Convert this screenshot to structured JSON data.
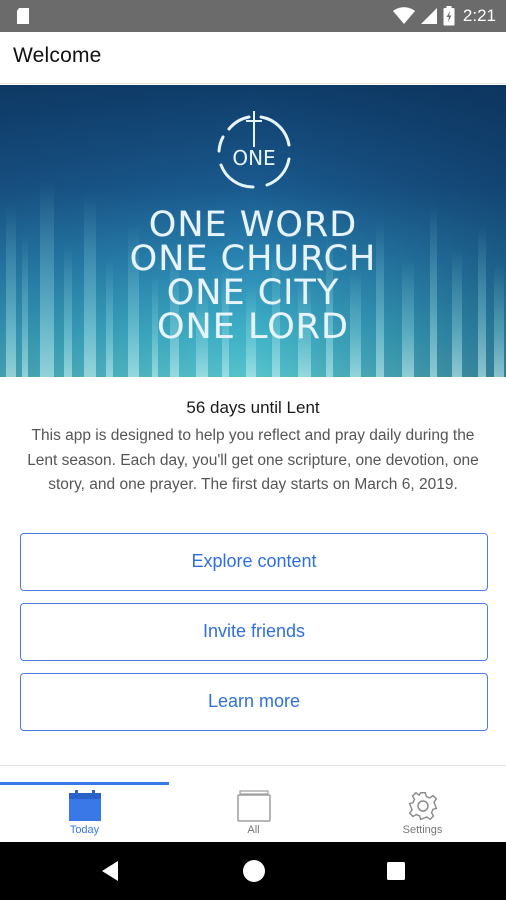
{
  "status_bar": {
    "time": "2:21",
    "left_icon": "sd-card-icon",
    "right_icons": [
      "wifi-icon",
      "signal-icon",
      "battery-icon"
    ]
  },
  "app_bar": {
    "title": "Welcome"
  },
  "hero": {
    "logo_text": "ONE",
    "lines": [
      "ONE WORD",
      "ONE CHURCH",
      "ONE CITY",
      "ONE LORD"
    ]
  },
  "main": {
    "countdown": "56 days until Lent",
    "description": "This app is designed to help you reflect and pray daily during the Lent season. Each day, you'll get one scripture, one devotion, one story, and one prayer. The first day starts on March 6, 2019.",
    "buttons": {
      "explore": "Explore content",
      "invite": "Invite friends",
      "learn": "Learn more"
    }
  },
  "bottom_nav": {
    "items": [
      {
        "label": "Today",
        "icon": "calendar-icon",
        "active": true
      },
      {
        "label": "All",
        "icon": "folder-icon",
        "active": false
      },
      {
        "label": "Settings",
        "icon": "gear-icon",
        "active": false
      }
    ]
  },
  "colors": {
    "accent": "#3b78e7",
    "button_text": "#2f6fe0",
    "status_bar": "#6b6b6b",
    "system_nav": "#000000"
  }
}
